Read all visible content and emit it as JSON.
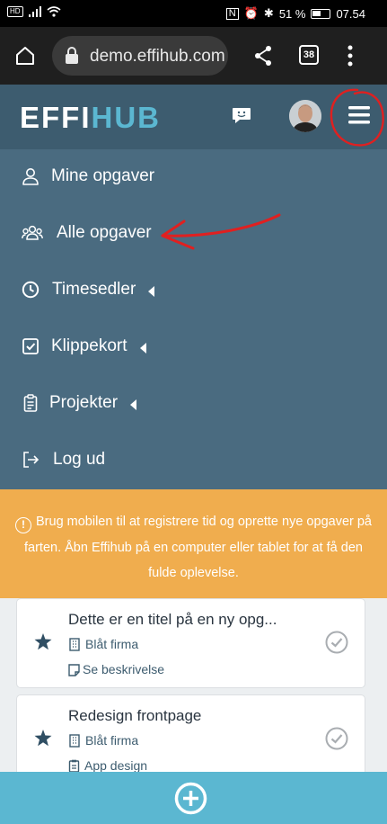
{
  "status_bar": {
    "battery_percent": "51 %",
    "time": "07.54"
  },
  "browser": {
    "url": "demo.effihub.com",
    "tab_count": "38"
  },
  "header": {
    "logo_part1": "EFFI",
    "logo_part2": "HUB"
  },
  "menu": {
    "items": [
      {
        "label": "Mine opgaver",
        "icon": "user-icon",
        "has_caret": false
      },
      {
        "label": "Alle opgaver",
        "icon": "users-icon",
        "has_caret": false
      },
      {
        "label": "Timesedler",
        "icon": "clock-icon",
        "has_caret": true
      },
      {
        "label": "Klippekort",
        "icon": "check-square-icon",
        "has_caret": true
      },
      {
        "label": "Projekter",
        "icon": "clipboard-icon",
        "has_caret": true
      },
      {
        "label": "Log ud",
        "icon": "logout-icon",
        "has_caret": false
      }
    ]
  },
  "notice": {
    "text": "Brug mobilen til at registrere tid og oprette nye opgaver på farten. Åbn Effihub på en computer eller tablet for at få den fulde oplevelse."
  },
  "tasks": [
    {
      "title": "Dette er en titel på en ny opg...",
      "company": "Blåt firma",
      "detail": "Se beskrivelse",
      "detail_icon": "note-icon"
    },
    {
      "title": "Redesign frontpage",
      "company": "Blåt firma",
      "detail": "App design",
      "detail_icon": "clipboard-icon"
    }
  ],
  "colors": {
    "header": "#3d5c6f",
    "menu": "#4a6b80",
    "accent": "#5bb7d1",
    "notice": "#f0ad4e",
    "annotation": "#e02020"
  }
}
